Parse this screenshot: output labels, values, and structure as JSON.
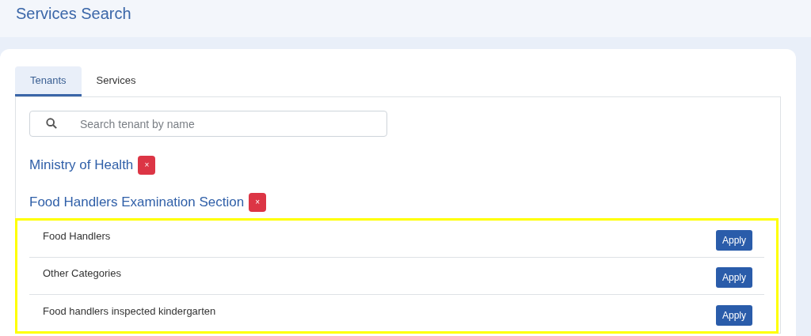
{
  "page_title": "Services Search",
  "tabs": [
    {
      "label": "Tenants",
      "selected": true
    },
    {
      "label": "Services",
      "selected": false
    }
  ],
  "search": {
    "placeholder": "Search tenant by name"
  },
  "tenants": [
    {
      "name": "Ministry of Health",
      "remove": "×"
    },
    {
      "name": "Food Handlers Examination Section",
      "remove": "×"
    }
  ],
  "highlighted": true,
  "services": [
    {
      "name": "Food Handlers",
      "action": "Apply"
    },
    {
      "name": "Other Categories",
      "action": "Apply"
    },
    {
      "name": "Food handlers inspected kindergarten",
      "action": "Apply"
    }
  ]
}
